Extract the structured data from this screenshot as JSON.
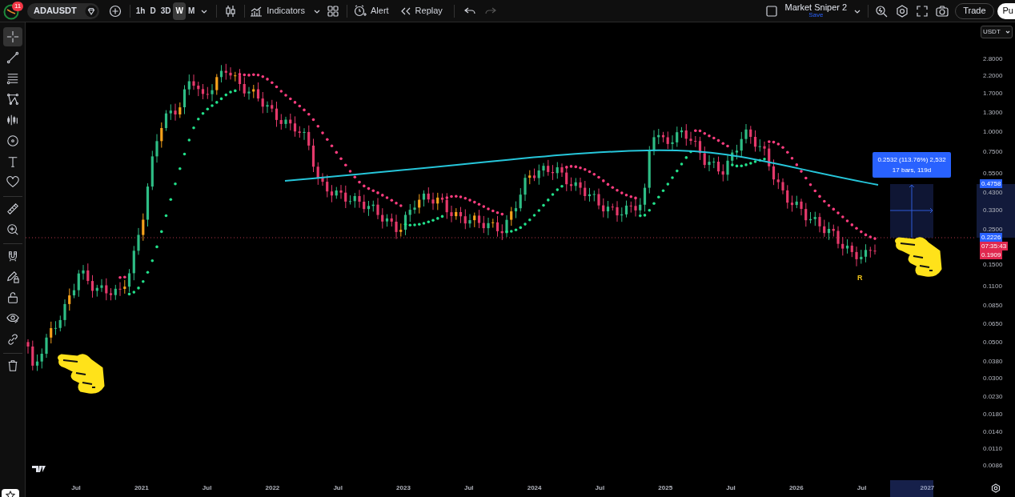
{
  "topbar": {
    "badge": "11",
    "symbol": "ADAUSDT",
    "intervals": [
      {
        "label": "1h",
        "selected": false
      },
      {
        "label": "D",
        "selected": false
      },
      {
        "label": "3D",
        "selected": false
      },
      {
        "label": "W",
        "selected": true
      },
      {
        "label": "M",
        "selected": false
      }
    ],
    "indicators": "Indicators",
    "alert": "Alert",
    "replay": "Replay",
    "undo": {
      "disabled": false
    },
    "redo": {
      "disabled": true
    },
    "layout_name": "Market Sniper 2",
    "layout_save": "Save",
    "trade": "Trade",
    "publish": "Pu"
  },
  "toolbar": {
    "groups": [
      {
        "tools": [
          {
            "selected": true
          },
          {
            "selected": false
          },
          {
            "selected": false
          },
          {
            "selected": false
          },
          {
            "selected": false
          },
          {
            "selected": false
          },
          {
            "selected": false
          },
          {
            "selected": false
          }
        ]
      },
      {
        "tools": [
          {
            "selected": false
          },
          {
            "selected": false
          }
        ]
      },
      {
        "tools": [
          {
            "selected": false
          },
          {
            "selected": false
          },
          {
            "selected": false
          },
          {
            "selected": false
          },
          {
            "selected": false
          }
        ]
      },
      {
        "tools": [
          {
            "selected": false
          }
        ]
      }
    ]
  },
  "chart": {
    "currency": "USDT",
    "price_ticks": [
      "2.8000",
      "2.2000",
      "1.7000",
      "1.3000",
      "1.0000",
      "0.7500",
      "0.5500",
      "0.4300",
      "0.3300",
      "0.2500",
      "0.1500",
      "0.1100",
      "0.0850",
      "0.0650",
      "0.0500",
      "0.0380",
      "0.0300",
      "0.0230",
      "0.0180",
      "0.0140",
      "0.0110",
      "0.0086"
    ],
    "time_ticks": [
      "Jul",
      "2021",
      "Jul",
      "2022",
      "Jul",
      "2023",
      "Jul",
      "2024",
      "Jul",
      "2025",
      "Jul",
      "2026",
      "Jul",
      "2027"
    ],
    "measure": {
      "line1": "0.2532 (113.76%) 2,532",
      "line2": "17 bars, 119d"
    },
    "price_tags": [
      {
        "text": "0.4758",
        "kind": "blue"
      },
      {
        "text": "0.2226",
        "kind": "blue"
      },
      {
        "text": "07:35:43",
        "kind": "red"
      },
      {
        "text": "0.1909",
        "kind": "red"
      }
    ],
    "marker": "R"
  }
}
